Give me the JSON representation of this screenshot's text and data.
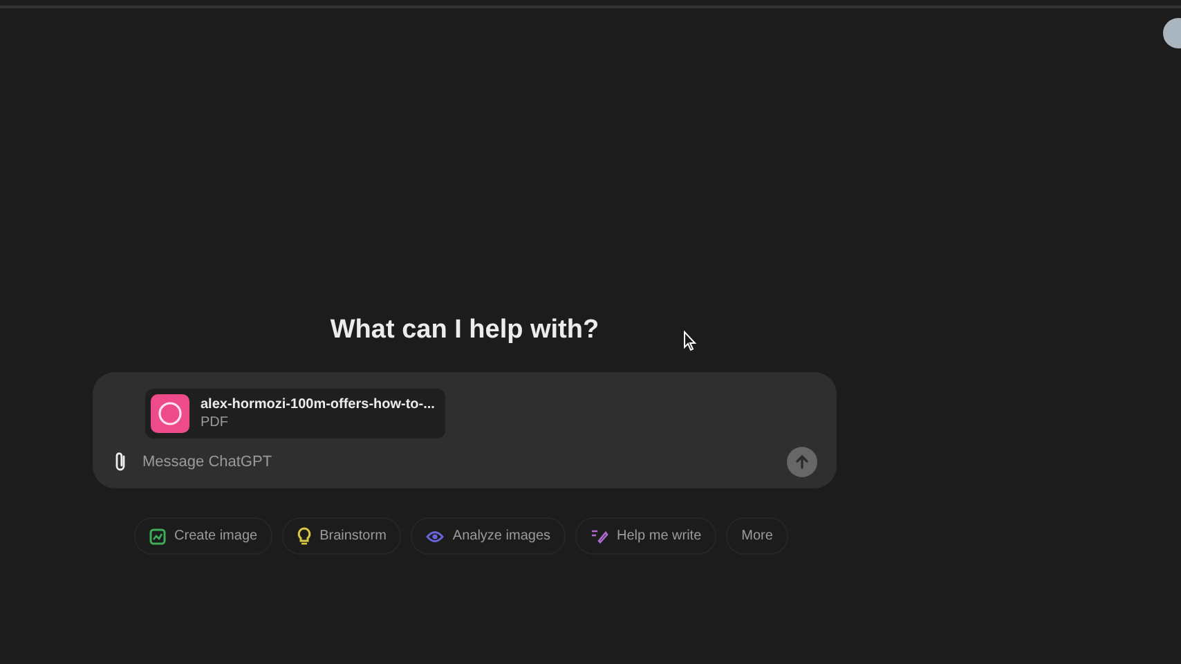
{
  "heading": "What can I help with?",
  "attachment": {
    "name": "alex-hormozi-100m-offers-how-to-...",
    "type": "PDF"
  },
  "composer": {
    "placeholder": "Message ChatGPT"
  },
  "suggestions": [
    {
      "kind": "image",
      "label": "Create image",
      "color": "#3fae5a"
    },
    {
      "kind": "idea",
      "label": "Brainstorm",
      "color": "#d8c843"
    },
    {
      "kind": "eye",
      "label": "Analyze images",
      "color": "#6b63d8"
    },
    {
      "kind": "write",
      "label": "Help me write",
      "color": "#b06ad0"
    },
    {
      "kind": "more",
      "label": "More"
    }
  ]
}
